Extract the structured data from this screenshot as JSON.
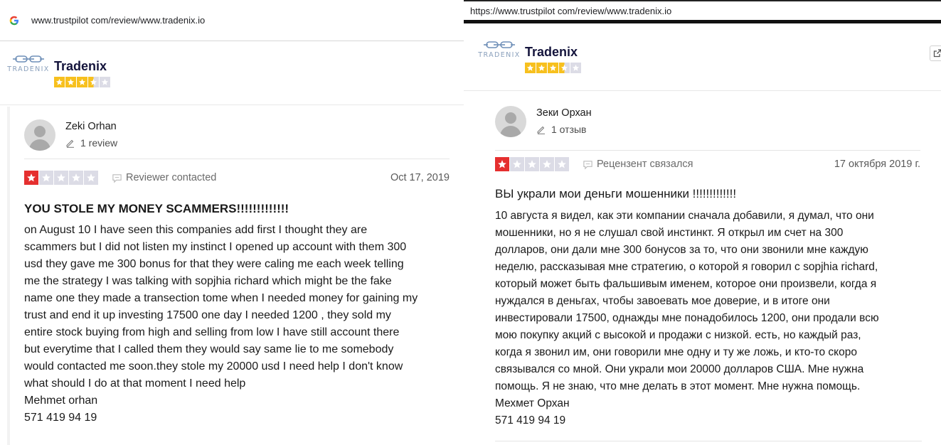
{
  "left": {
    "url": "www.trustpilot com/review/www.tradenix.io",
    "company": {
      "name": "Tradenix",
      "logo_text": "TRADENIX",
      "rating_stars": 3.5
    },
    "review": {
      "reviewer_name": "Zeki Orhan",
      "review_count": "1 review",
      "stars": 1,
      "contacted": "Reviewer contacted",
      "date": "Oct 17, 2019",
      "title": "YOU STOLE MY MONEY SCAMMERS!!!!!!!!!!!!!",
      "body_lines": [
        "on August 10 I have seen this companies add first I thought they are",
        "scammers but I did not listen my instinct I opened up account with them 300",
        "usd they gave me 300 bonus for that they were caling me each week telling",
        "me the strategy I was talking with sopjhia richard which might be the fake",
        "name one they made a transection tome when I needed money for gaining my",
        "trust and end it up investing 17500 one day I needed 1200 , they sold my",
        "entire stock buying from high and selling from low I have still account there",
        "but everytime that I called them they would say same lie to me somebody",
        "would contacted me soon.they stole my 20000 usd I need help I don't know",
        "what should I do at that moment I need help",
        "Mehmet orhan",
        "571 419 94 19"
      ]
    }
  },
  "right": {
    "url": "https://www.trustpilot com/review/www.tradenix.io",
    "company": {
      "name": "Tradenix",
      "logo_text": "TRADENIX",
      "rating_stars": 3.5
    },
    "review": {
      "reviewer_name": "Зеки Орхан",
      "review_count": "1 отзыв",
      "stars": 1,
      "contacted": "Рецензент связался",
      "date": "17 октября 2019 г.",
      "title": "ВЫ украли мои деньги мошенники !!!!!!!!!!!!!",
      "body_lines": [
        "10 августа я видел, как эти компании сначала добавили, я думал, что они",
        "мошенники, но я не слушал свой инстинкт. Я открыл им счет на 300",
        "долларов, они дали мне 300 бонусов за то, что они звонили мне каждую",
        "неделю, рассказывая мне стратегию, о которой я говорил с sopjhia richard,",
        "который может быть фальшивым именем, которое они произвели, когда я",
        "нуждался в деньгах, чтобы завоевать мое доверие, и в итоге они",
        "инвестировали 17500, однажды мне понадобилось 1200, они продали всю",
        "мою покупку акций с высокой и продажи с низкой. есть, но каждый раз,",
        "когда я звонил им, они говорили мне одну и ту же ложь, и кто-то скоро",
        "связывался со мной. Они украли мои 20000 долларов США. Мне нужна",
        "помощь. Я не знаю, что мне делать в этот момент. Мне нужна помощь.",
        "Мехмет Орхан",
        "571 419 94 19"
      ]
    }
  },
  "colors": {
    "star_red": "#e52f2f",
    "star_gold": "#f7c01e",
    "star_empty": "#dcdce6",
    "company_name": "#14143c",
    "logo_blue": "#8aa0bc"
  }
}
